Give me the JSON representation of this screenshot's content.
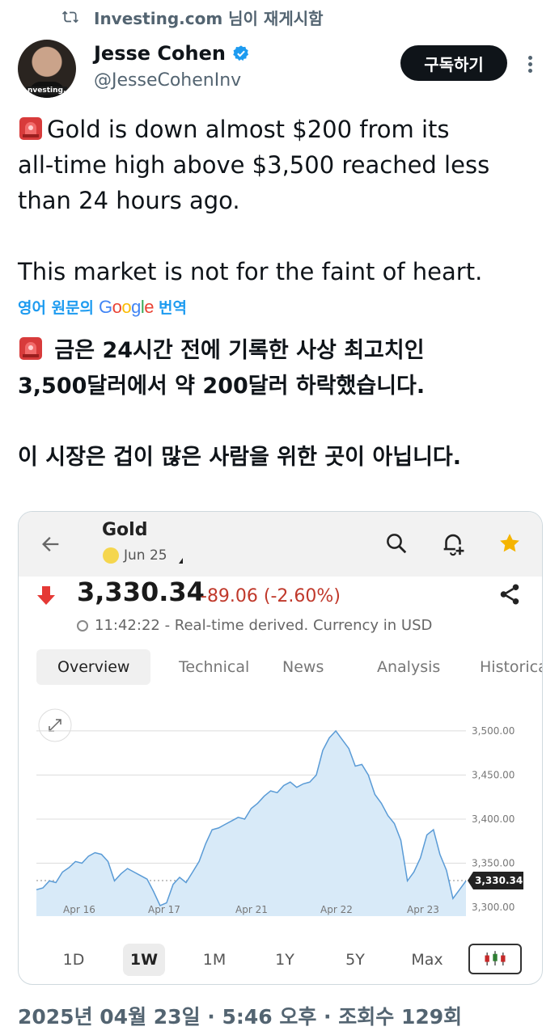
{
  "retweet": {
    "text": "Investing.com 님이 재게시함"
  },
  "author": {
    "name": "Jesse Cohen",
    "handle": "@JesseCohenInv",
    "avatar_badge": "nvesting."
  },
  "follow_label": "구독하기",
  "tweet": {
    "original": "Gold is down almost $200 from its\nall-time high above $3,500 reached less\nthan 24 hours ago.\n\nThis market is not for the faint of heart.",
    "translated": " 금은 24시간 전에 기록한 사상 최고치인\n3,500달러에서 약 200달러 하락했습니다.\n\n이 시장은 겁이 많은 사람을 위한 곳이 아닙니다."
  },
  "translate": {
    "prefix": "영어 원문의",
    "google": "Google",
    "suffix": "번역"
  },
  "card": {
    "title": "Gold",
    "date": "Jun 25",
    "price": "3,330.34",
    "change": "-89.06 (-2.60%)",
    "time_text": "11:42:22 - Real-time derived. Currency in USD",
    "tabs": [
      "Overview",
      "Technical",
      "News",
      "Analysis",
      "Historica"
    ],
    "ranges": [
      "1D",
      "1W",
      "1M",
      "1Y",
      "5Y",
      "Max"
    ],
    "active_range": "1W",
    "current_label": "3,330.34"
  },
  "footer": "2025년 04월 23일 · 5:46 오후 · 조회수 129회",
  "chart_data": {
    "type": "area",
    "title": "",
    "x_tick_labels": [
      "Apr 16",
      "Apr 17",
      "Apr 21",
      "Apr 22",
      "Apr 23"
    ],
    "y_ticks": [
      "3,300.00",
      "3,350.00",
      "3,400.00",
      "3,450.00",
      "3,500.00"
    ],
    "ylim": [
      3290,
      3510
    ],
    "current_value": 3330.34,
    "series": [
      {
        "values": [
          3320,
          3322,
          3330,
          3328,
          3340,
          3345,
          3352,
          3350,
          3358,
          3362,
          3360,
          3352,
          3330,
          3338,
          3344,
          3340,
          3336,
          3332,
          3318,
          3302,
          3305,
          3326,
          3334,
          3328,
          3340,
          3352,
          3372,
          3388,
          3390,
          3394,
          3398,
          3402,
          3400,
          3412,
          3418,
          3426,
          3432,
          3430,
          3438,
          3442,
          3436,
          3440,
          3442,
          3450,
          3478,
          3492,
          3500,
          3490,
          3480,
          3460,
          3462,
          3450,
          3428,
          3418,
          3404,
          3395,
          3376,
          3330,
          3340,
          3356,
          3382,
          3388,
          3360,
          3342,
          3310,
          3320,
          3330
        ]
      }
    ],
    "grid": true,
    "legend": "none"
  }
}
